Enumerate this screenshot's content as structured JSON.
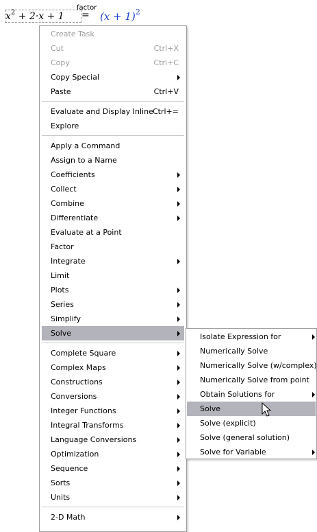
{
  "expression": {
    "lhs": "x",
    "lhs_exp": "2",
    "lhs_rest": " + 2·x + 1",
    "operator_label": "factor",
    "equals": "=",
    "rhs": "(x + 1)",
    "rhs_exp": "2"
  },
  "context_menu": {
    "groups": [
      [
        {
          "label": "Create Task",
          "shortcut": "",
          "submenu": false,
          "disabled": true
        },
        {
          "label": "Cut",
          "shortcut": "Ctrl+X",
          "submenu": false,
          "disabled": true
        },
        {
          "label": "Copy",
          "shortcut": "Ctrl+C",
          "submenu": false,
          "disabled": true
        },
        {
          "label": "Copy Special",
          "shortcut": "",
          "submenu": true,
          "disabled": false
        },
        {
          "label": "Paste",
          "shortcut": "Ctrl+V",
          "submenu": false,
          "disabled": false
        }
      ],
      [
        {
          "label": "Evaluate and Display Inline",
          "shortcut": "Ctrl+=",
          "submenu": false,
          "disabled": false
        },
        {
          "label": "Explore",
          "shortcut": "",
          "submenu": false,
          "disabled": false
        }
      ],
      [
        {
          "label": "Apply a Command",
          "shortcut": "",
          "submenu": false,
          "disabled": false
        },
        {
          "label": "Assign to a Name",
          "shortcut": "",
          "submenu": false,
          "disabled": false
        },
        {
          "label": "Coefficients",
          "shortcut": "",
          "submenu": true,
          "disabled": false
        },
        {
          "label": "Collect",
          "shortcut": "",
          "submenu": true,
          "disabled": false
        },
        {
          "label": "Combine",
          "shortcut": "",
          "submenu": true,
          "disabled": false
        },
        {
          "label": "Differentiate",
          "shortcut": "",
          "submenu": true,
          "disabled": false
        },
        {
          "label": "Evaluate at a Point",
          "shortcut": "",
          "submenu": false,
          "disabled": false
        },
        {
          "label": "Factor",
          "shortcut": "",
          "submenu": false,
          "disabled": false
        },
        {
          "label": "Integrate",
          "shortcut": "",
          "submenu": true,
          "disabled": false
        },
        {
          "label": "Limit",
          "shortcut": "",
          "submenu": false,
          "disabled": false
        },
        {
          "label": "Plots",
          "shortcut": "",
          "submenu": true,
          "disabled": false
        },
        {
          "label": "Series",
          "shortcut": "",
          "submenu": true,
          "disabled": false
        },
        {
          "label": "Simplify",
          "shortcut": "",
          "submenu": true,
          "disabled": false
        },
        {
          "label": "Solve",
          "shortcut": "",
          "submenu": true,
          "disabled": false,
          "highlighted": true
        }
      ],
      [
        {
          "label": "Complete Square",
          "shortcut": "",
          "submenu": true,
          "disabled": false
        },
        {
          "label": "Complex Maps",
          "shortcut": "",
          "submenu": true,
          "disabled": false
        },
        {
          "label": "Constructions",
          "shortcut": "",
          "submenu": true,
          "disabled": false
        },
        {
          "label": "Conversions",
          "shortcut": "",
          "submenu": true,
          "disabled": false
        },
        {
          "label": "Integer Functions",
          "shortcut": "",
          "submenu": true,
          "disabled": false
        },
        {
          "label": "Integral Transforms",
          "shortcut": "",
          "submenu": true,
          "disabled": false
        },
        {
          "label": "Language Conversions",
          "shortcut": "",
          "submenu": true,
          "disabled": false
        },
        {
          "label": "Optimization",
          "shortcut": "",
          "submenu": true,
          "disabled": false
        },
        {
          "label": "Sequence",
          "shortcut": "",
          "submenu": true,
          "disabled": false
        },
        {
          "label": "Sorts",
          "shortcut": "",
          "submenu": true,
          "disabled": false
        },
        {
          "label": "Units",
          "shortcut": "",
          "submenu": true,
          "disabled": false
        }
      ],
      [
        {
          "label": "2-D Math",
          "shortcut": "",
          "submenu": true,
          "disabled": false
        }
      ]
    ]
  },
  "solve_submenu": {
    "items": [
      {
        "label": "Isolate Expression for",
        "submenu": true
      },
      {
        "label": "Numerically Solve",
        "submenu": false
      },
      {
        "label": "Numerically Solve (w/complex)",
        "submenu": false
      },
      {
        "label": "Numerically Solve from point",
        "submenu": false
      },
      {
        "label": "Obtain Solutions for",
        "submenu": true
      },
      {
        "label": "Solve",
        "submenu": false,
        "highlighted": true
      },
      {
        "label": "Solve (explicit)",
        "submenu": false
      },
      {
        "label": "Solve (general solution)",
        "submenu": false
      },
      {
        "label": "Solve for Variable",
        "submenu": true
      }
    ]
  },
  "colors": {
    "highlight": "#b3b3bb",
    "disabled_text": "#9b9b9b",
    "result_blue": "#1e3fcc"
  },
  "icons": {
    "submenu_arrow": "chevron-right-icon",
    "cursor": "mouse-pointer-icon"
  }
}
